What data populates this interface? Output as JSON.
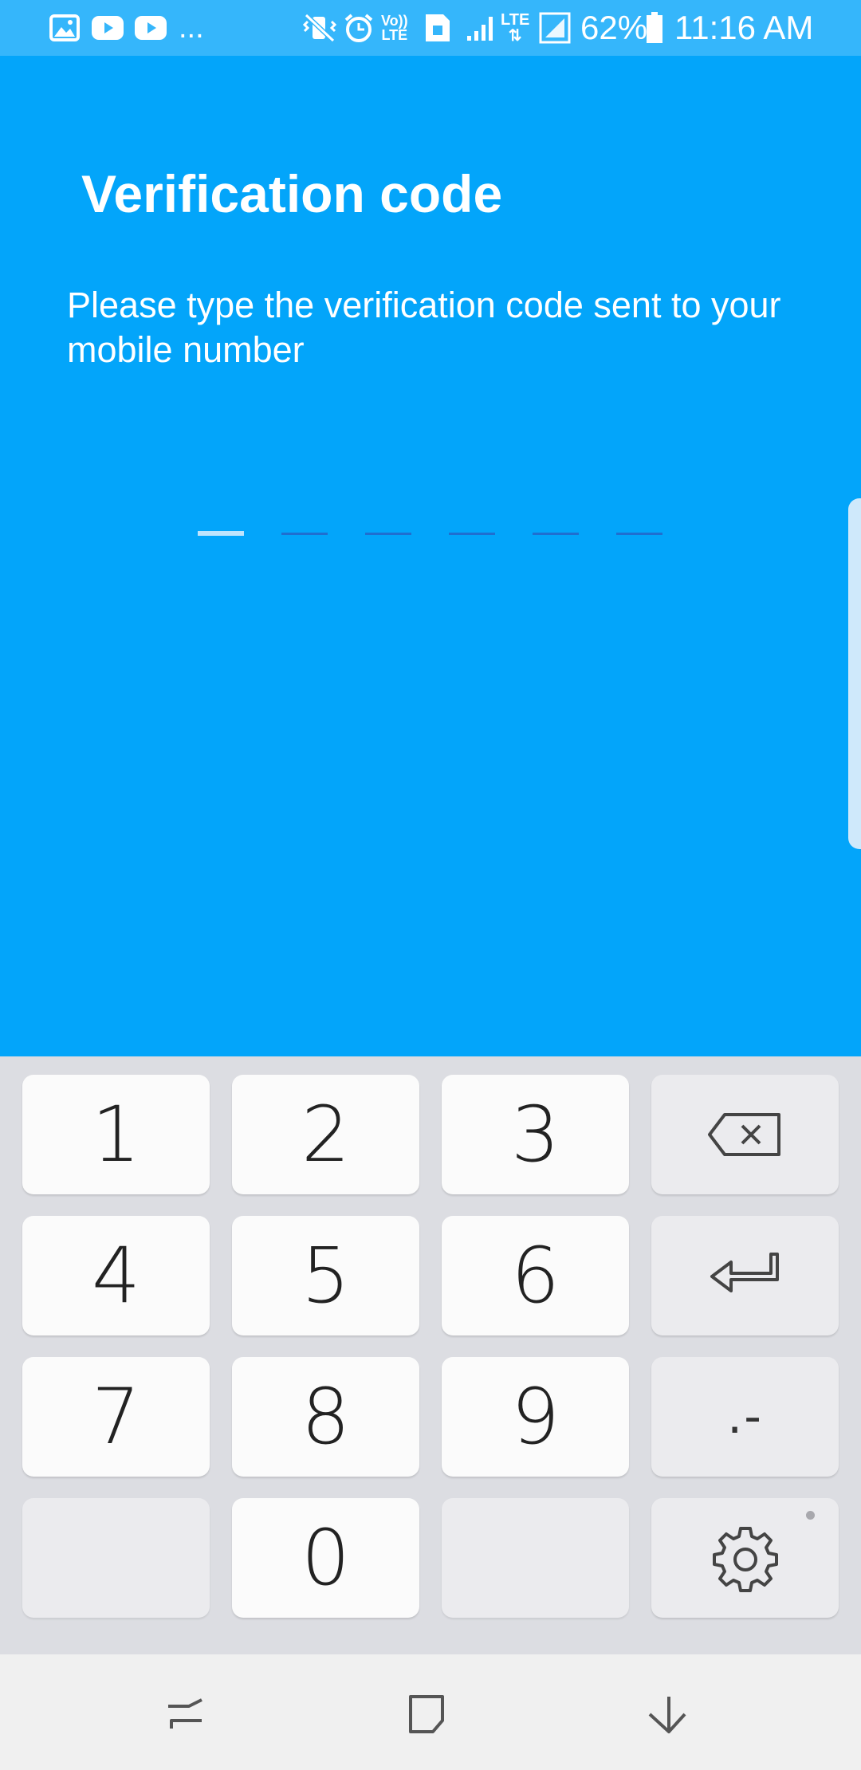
{
  "status_bar": {
    "notification_icons": [
      "image-icon",
      "youtube-icon",
      "youtube-icon"
    ],
    "overflow": "...",
    "system_icons": [
      "vibrate-icon",
      "alarm-icon",
      "volte-icon",
      "sim-icon",
      "signal-icon",
      "lte-signal-icon"
    ],
    "volte_label": "Vo)) LTE",
    "lte_label": "LTE",
    "battery": "62%",
    "time": "11:16 AM"
  },
  "verification": {
    "title": "Verification code",
    "subtitle": "Please type the verification code sent to your mobile number",
    "code_length": 6,
    "active_slot": 1
  },
  "keyboard": {
    "rows": [
      [
        {
          "label": "1",
          "type": "num"
        },
        {
          "label": "2",
          "type": "num"
        },
        {
          "label": "3",
          "type": "num"
        },
        {
          "icon": "backspace-icon",
          "type": "fn"
        }
      ],
      [
        {
          "label": "4",
          "type": "num"
        },
        {
          "label": "5",
          "type": "num"
        },
        {
          "label": "6",
          "type": "num"
        },
        {
          "icon": "enter-icon",
          "type": "fn"
        }
      ],
      [
        {
          "label": "7",
          "type": "num"
        },
        {
          "label": "8",
          "type": "num"
        },
        {
          "label": "9",
          "type": "num"
        },
        {
          "label": ".-",
          "type": "fn"
        }
      ],
      [
        {
          "label": "",
          "type": "blank"
        },
        {
          "label": "0",
          "type": "num"
        },
        {
          "label": "",
          "type": "blank"
        },
        {
          "icon": "settings-icon",
          "type": "fn"
        }
      ]
    ]
  },
  "nav_bar": {
    "buttons": [
      "recent-apps-icon",
      "home-icon",
      "back-icon"
    ]
  },
  "colors": {
    "accent": "#03a5fa",
    "status_bar": "#35b6fb",
    "keyboard_bg": "#dcdde2",
    "key_bg": "#fbfbfb"
  }
}
